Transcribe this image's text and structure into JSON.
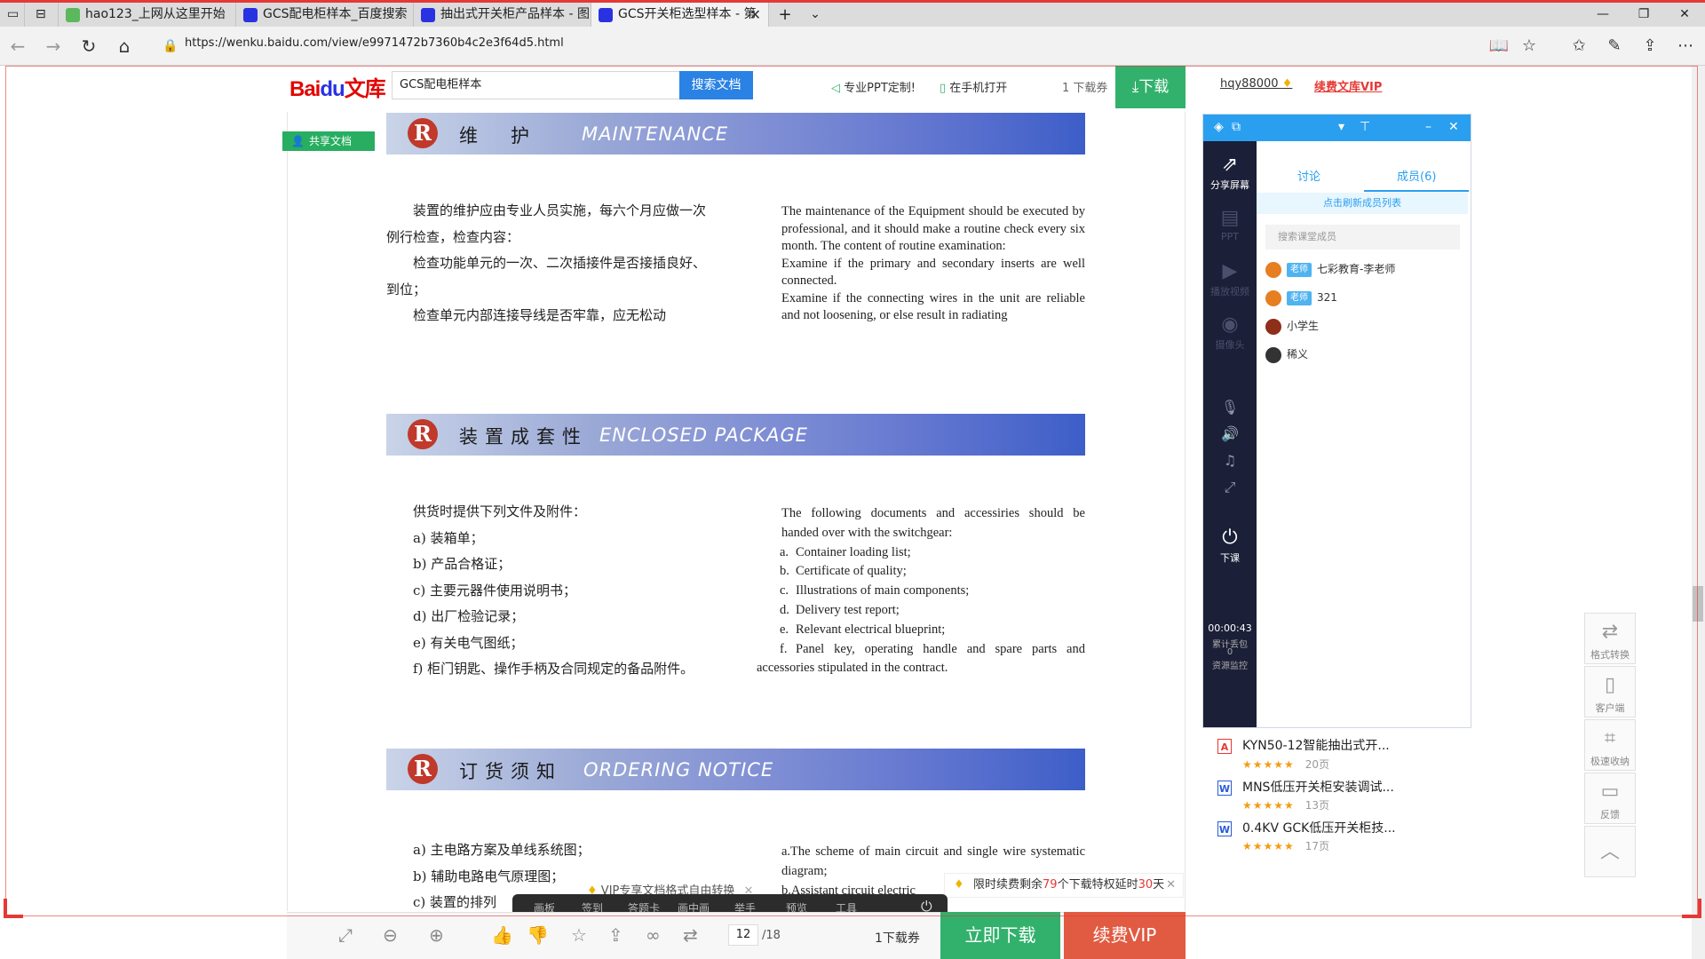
{
  "browser": {
    "tabs": [
      {
        "title": "hao123_上网从这里开始",
        "icon_color": "#5cb85c"
      },
      {
        "title": "GCS配电柜样本_百度搜索",
        "icon_color": "#2932e1"
      },
      {
        "title": "抽出式开关柜产品样本 - 图:",
        "icon_color": "#2932e1"
      },
      {
        "title": "GCS开关柜选型样本 - 第",
        "icon_color": "#2932e1"
      }
    ],
    "active_tab": 3,
    "url": "https://wenku.baidu.com/view/e9971472b7360b4c2e3f64d5.html"
  },
  "header": {
    "logo_text": "Bai",
    "logo_paw": "du",
    "logo_suffix": "文库",
    "search_value": "GCS配电柜样本",
    "search_button": "搜索文档",
    "ppt_link": "专业PPT定制!",
    "mobile_link": "在手机打开",
    "coupon": "1 下载券",
    "download": "下载",
    "username": "hqy88000",
    "renew_vip": "续费文库VIP"
  },
  "document": {
    "shared_tag": "共享文档",
    "sections": [
      {
        "cn_title": "维　护",
        "en_title": "MAINTENANCE",
        "cn_paras": [
          "　　装置的维护应由专业人员实施，每六个月应做一次例行检查，检查内容：",
          "　　检查功能单元的一次、二次插接件是否接插良好、到位；",
          "　　检查单元内部连接导线是否牢靠，应无松动"
        ],
        "en_paras": [
          "The maintenance of the Equipment should be executed by professional, and it should make a routine check every six month. The content of routine examination:",
          "Examine if the primary and secondary inserts are well connected.",
          "Examine if the connecting wires in the unit are reliable and not loosening, or else result in radiating"
        ]
      },
      {
        "cn_title": "装置成套性",
        "en_title": "ENCLOSED PACKAGE",
        "cn_paras": [
          "　　供货时提供下列文件及附件：",
          "　　a) 装箱单；",
          "　　b) 产品合格证；",
          "　　c) 主要元器件使用说明书；",
          "　　d) 出厂检验记录；",
          "　　e) 有关电气图纸；",
          "　　f) 柜门钥匙、操作手柄及合同规定的备品附件。"
        ],
        "en_intro": "The following documents and accessiries should be handed over with the switchgear:",
        "en_list": [
          {
            "letter": "a.",
            "text": "Container loading list;"
          },
          {
            "letter": "b.",
            "text": "Certificate of quality;"
          },
          {
            "letter": "c.",
            "text": "Illustrations of main components;"
          },
          {
            "letter": "d.",
            "text": "Delivery test report;"
          },
          {
            "letter": "e.",
            "text": "Relevant electrical blueprint;"
          },
          {
            "letter": "f.",
            "text": "Panel key, operating handle and spare parts and accessories stipulated in the contract."
          }
        ]
      },
      {
        "cn_title": "订货须知",
        "en_title": "ORDERING NOTICE",
        "cn_paras": [
          "　　a) 主电路方案及单线系统图；",
          "　　b) 辅助电路电气原理图；",
          "　　c) 装置的排列"
        ],
        "en_paras": [
          "a.The scheme of main circuit and single wire systematic diagram;",
          "b.Assistant circuit electric"
        ]
      }
    ]
  },
  "overlays": {
    "vip_tip": "VIP专享文档格式自由转换",
    "promo_prefix": "限时续费剩余",
    "promo_count": "79",
    "promo_mid": "个下载特权延时",
    "promo_days": "30",
    "promo_suffix": "天",
    "dark_toolbar": [
      "画板",
      "签到",
      "答题卡",
      "画中画",
      "举手",
      "预览",
      "工具"
    ]
  },
  "bottom": {
    "page_current": "12",
    "page_total": "/18",
    "coupon": "1下载券",
    "download_now": "立即下载",
    "renew_vip": "续费VIP"
  },
  "classroom": {
    "left_items": [
      "分享屏幕",
      "PPT",
      "播放视频",
      "摄像头",
      "下课"
    ],
    "tabs": [
      "讨论",
      "成员(6)"
    ],
    "refresh": "点击刷新成员列表",
    "search_placeholder": "搜索课堂成员",
    "members": [
      {
        "name": "七彩教育-李老师",
        "badge": "老师",
        "color": "#e67e22"
      },
      {
        "name": "321",
        "badge": "老师",
        "color": "#e67e22"
      },
      {
        "name": "小学生",
        "badge": "",
        "color": "#8e2f1a"
      },
      {
        "name": "稀义",
        "badge": "",
        "color": "#333333"
      }
    ],
    "timer": "00:00:43",
    "stats_label": "累计丢包",
    "stats_value": "0",
    "resource_label": "资源监控"
  },
  "related": [
    {
      "title": "KYN50-12智能抽出式开...",
      "pages": "20页",
      "type": "pdf"
    },
    {
      "title": "MNS低压开关柜安装调试...",
      "pages": "13页",
      "type": "word"
    },
    {
      "title": "0.4KV GCK低压开关柜技...",
      "pages": "17页",
      "type": "word"
    }
  ],
  "float_tools": [
    "格式转换",
    "客户端",
    "极速收纳",
    "反馈"
  ]
}
